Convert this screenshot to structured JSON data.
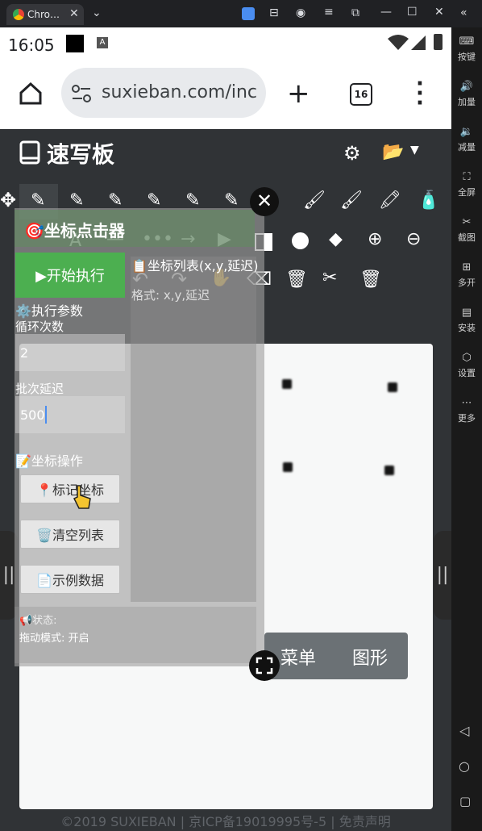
{
  "window": {
    "tab_title": "Chro…",
    "controls": [
      "minimize-icon",
      "maximize-icon",
      "close-icon"
    ]
  },
  "statusbar": {
    "time": "16:05"
  },
  "browser": {
    "url": "suxieban.com/inc",
    "tab_count": "16"
  },
  "sidebar": {
    "items": [
      {
        "label": "按键",
        "icon": "keyboard-icon"
      },
      {
        "label": "加量",
        "icon": "volume-up-icon"
      },
      {
        "label": "减量",
        "icon": "volume-down-icon"
      },
      {
        "label": "全屏",
        "icon": "fullscreen-icon"
      },
      {
        "label": "截图",
        "icon": "scissors-icon"
      },
      {
        "label": "多开",
        "icon": "multi-window-icon"
      },
      {
        "label": "安装",
        "icon": "apk-icon"
      },
      {
        "label": "设置",
        "icon": "settings-icon"
      },
      {
        "label": "更多",
        "icon": "more-icon"
      }
    ]
  },
  "app": {
    "brand": "速写板",
    "footer": "©2019 SUXIEBAN | 京ICP备19019995号-5 | 免责声明"
  },
  "clicker": {
    "title": "🎯坐标点击器",
    "start_label": "▶开始执行",
    "params_title": "⚙️执行参数",
    "loop_label": "循环次数",
    "loop_value": "2",
    "delay_label": "批次延迟",
    "delay_value": "500",
    "ops_title": "📝坐标操作",
    "mark_label": "📍标记坐标",
    "clear_label": "🗑️清空列表",
    "example_label": "📄示例数据",
    "list_title": "📋坐标列表(x,y,延迟)",
    "list_hint": "格式: x,y,延迟",
    "status_label": "📢状态:",
    "drag_mode": "拖动模式: 开启"
  },
  "floating_menu": {
    "menu": "菜单",
    "shape": "图形"
  },
  "colors": {
    "accent_green": "#4caf50",
    "page_bg": "#303336",
    "canvas_bg": "#f7f8f8"
  }
}
